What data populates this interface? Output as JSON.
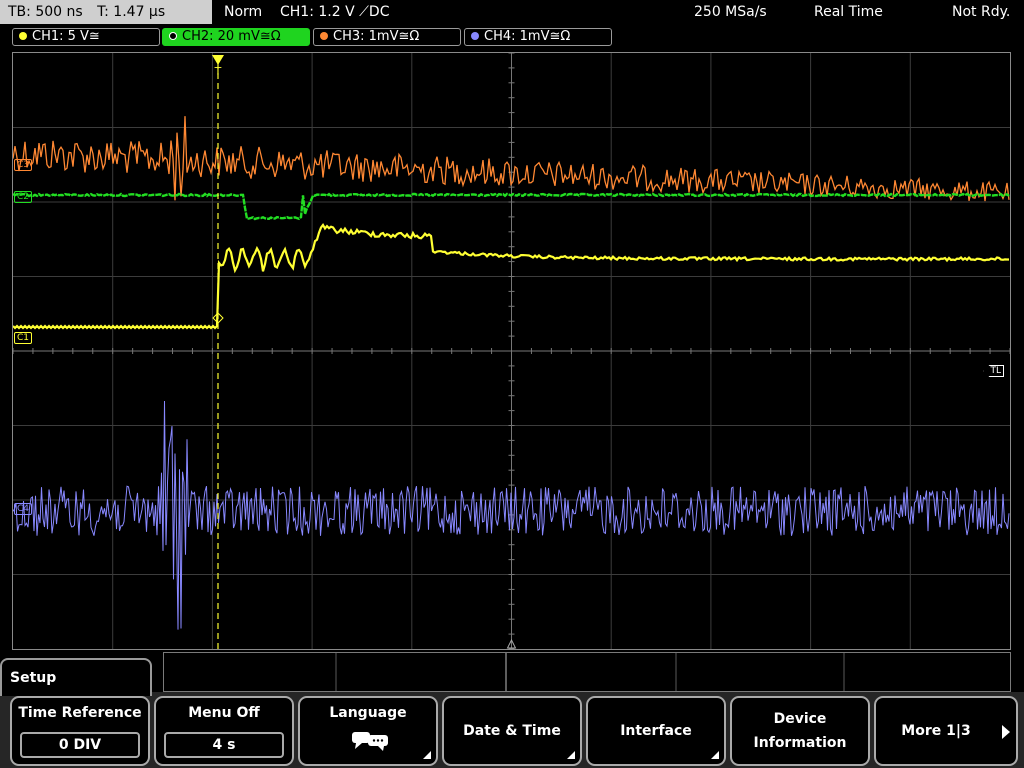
{
  "status": {
    "timebase": "TB: 500 ns",
    "trigger_time": "T: 1.47 µs",
    "mode": "Norm",
    "trigger_setting": "CH1: 1.2 V ⟋DC",
    "sample_rate": "250 MSa/s",
    "acq_mode": "Real Time",
    "state": "Not Rdy."
  },
  "channels": [
    {
      "id": "ch1",
      "label": "CH1: 5 V≅",
      "color": "#ffff33",
      "trace_label": "C1"
    },
    {
      "id": "ch2",
      "label": "CH2: 20 mV≅Ω",
      "color": "#22dd22",
      "trace_label": "C2"
    },
    {
      "id": "ch3",
      "label": "CH3: 1mV≅Ω",
      "color": "#ff8833",
      "trace_label": "C3"
    },
    {
      "id": "ch4",
      "label": "CH4: 1mV≅Ω",
      "color": "#8888ff",
      "trace_label": "C4"
    }
  ],
  "active_channel": "ch2",
  "trigger_level_marker": "TL",
  "trigger_position_marker": "T",
  "menu": {
    "title": "Setup",
    "softkeys": [
      {
        "label": "Time Reference",
        "value": "0 DIV"
      },
      {
        "label": "Menu Off",
        "value": "4 s"
      },
      {
        "label": "Language",
        "icon": "speech-bubbles-icon"
      },
      {
        "label": "Date & Time"
      },
      {
        "label": "Interface"
      },
      {
        "label_line1": "Device",
        "label_line2": "Information"
      },
      {
        "label": "More 1|3"
      }
    ]
  },
  "colors": {
    "ch1": "#ffff33",
    "ch2": "#22dd22",
    "ch3": "#ff8833",
    "ch4": "#8888ff",
    "grid": "#5a5a5a",
    "active_tab": "#1fd41f"
  }
}
